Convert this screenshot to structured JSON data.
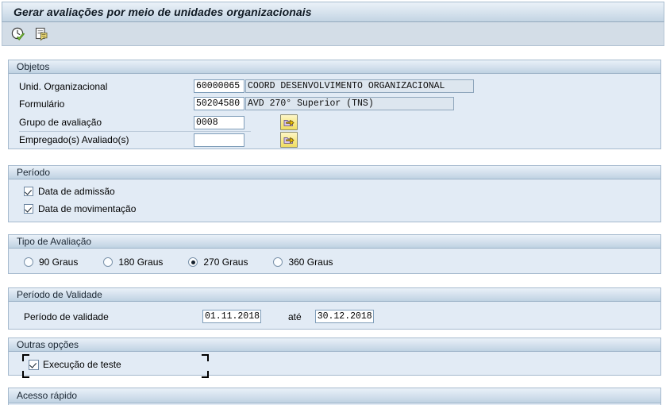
{
  "window": {
    "title": "Gerar avaliações por meio de unidades organizacionais"
  },
  "toolbar": {
    "buttons": [
      {
        "name": "execute-icon",
        "tooltip": "Executar"
      },
      {
        "name": "execute-background-icon",
        "tooltip": "Executar em background"
      }
    ]
  },
  "colors": {
    "title_bar_top": "#eaf1f8",
    "title_bar_bottom": "#c3d4e3",
    "group_bg": "#e2ebf5",
    "toolbar_bg": "#d3dde7",
    "field_border": "#7f9db9",
    "readonly_bg": "#dde6ef",
    "focus_bracket": "#c9204a",
    "yellow_button": "#f7e98a"
  },
  "sections": {
    "objetos": {
      "header": "Objetos",
      "fields": [
        {
          "label": "Unid. Organizacional",
          "key_value": "60000065",
          "description": "COORD  DESENVOLVIMENTO ORGANIZACIONAL",
          "has_helper_button": false
        },
        {
          "label": "Formulário",
          "key_value": "50204580",
          "description": "AVD 270° Superior (TNS)",
          "has_helper_button": false
        },
        {
          "label": "Grupo de avaliação",
          "key_value": "0008",
          "description": "",
          "has_helper_button": true
        },
        {
          "label": "Empregado(s) Avaliado(s)",
          "key_value": "",
          "description": "",
          "has_helper_button": true
        }
      ]
    },
    "periodo": {
      "header": "Período",
      "checkboxes": [
        {
          "label": "Data de admissão",
          "checked": true
        },
        {
          "label": "Data de movimentação",
          "checked": true
        }
      ]
    },
    "tipo_avaliacao": {
      "header": "Tipo de Avaliação",
      "options": [
        {
          "label": "90 Graus",
          "selected": false
        },
        {
          "label": "180 Graus",
          "selected": false
        },
        {
          "label": "270 Graus",
          "selected": true
        },
        {
          "label": "360 Graus",
          "selected": false
        }
      ]
    },
    "periodo_validade": {
      "header": "Período de Validade",
      "label": "Período de validade",
      "date_from": "01.11.2018",
      "separator_label": "até",
      "date_to": "30.12.2018"
    },
    "outras_opcoes": {
      "header": "Outras opções",
      "checkbox": {
        "label": "Execução de teste",
        "checked": true
      }
    },
    "acesso_rapido": {
      "header": "Acesso rápido"
    }
  }
}
